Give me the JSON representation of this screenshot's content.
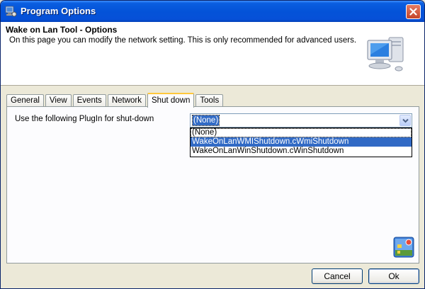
{
  "window": {
    "title": "Program Options",
    "title_icon": "options-app-icon",
    "close_icon": "close-icon"
  },
  "header": {
    "title": "Wake on Lan Tool - Options",
    "description": "On this page you can modify the network setting. This is only recommended for advanced users.",
    "icon": "computer-icon"
  },
  "tabs": [
    {
      "label": "General",
      "active": false
    },
    {
      "label": "View",
      "active": false
    },
    {
      "label": "Events",
      "active": false
    },
    {
      "label": "Network",
      "active": false
    },
    {
      "label": "Shut down",
      "active": true
    },
    {
      "label": "Tools",
      "active": false
    }
  ],
  "shutdown": {
    "plugin_label": "Use the following PlugIn for shut-down",
    "selected": "(None)",
    "options": [
      "(None)",
      "WakeOnLanWMIShutdown.cWmiShutdown",
      "WakeOnLanWinShutdown.cWinShutdown"
    ],
    "highlighted_index": 1
  },
  "buttons": {
    "cancel": "Cancel",
    "ok": "Ok"
  },
  "colors": {
    "titlebar": "#0453d8",
    "selection": "#316ac5",
    "face": "#ece9d8",
    "active_tab_accent": "#ffc83c"
  }
}
